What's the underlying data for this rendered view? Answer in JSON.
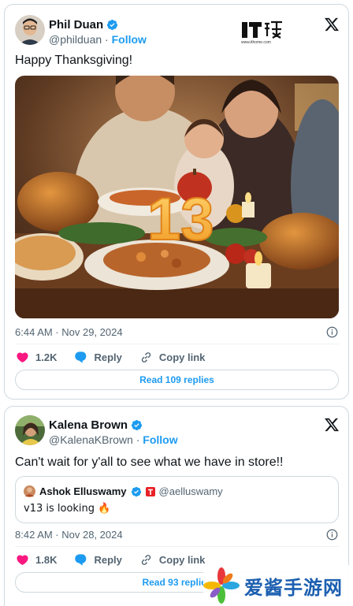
{
  "tweets": [
    {
      "author": {
        "name": "Phil Duan",
        "handle": "@philduan",
        "follow_label": "Follow"
      },
      "text": "Happy Thanksgiving!",
      "timestamp": "6:44 AM · Nov 29, 2024",
      "likes": "1.2K",
      "reply_label": "Reply",
      "copy_link_label": "Copy link",
      "read_replies_label": "Read 109 replies",
      "image_overlay_number": "13"
    },
    {
      "author": {
        "name": "Kalena Brown",
        "handle": "@KalenaKBrown",
        "follow_label": "Follow"
      },
      "text": "Can't wait for y'all to see what we have in store!!",
      "quote": {
        "name": "Ashok Elluswamy",
        "handle": "@aelluswamy",
        "text": "v13 is looking 🔥"
      },
      "timestamp": "8:42 AM · Nov 28, 2024",
      "likes": "1.8K",
      "reply_label": "Reply",
      "copy_link_label": "Copy link",
      "read_replies_label": "Read 93 replies"
    }
  ],
  "watermark": {
    "site": "www.ithome.com"
  },
  "brand": {
    "text": "爱酱手游网"
  },
  "colors": {
    "accent": "#1d9bf0",
    "heart": "#f91880",
    "text": "#0f1419",
    "muted": "#536471",
    "border": "#cfd9de"
  },
  "icons": [
    "verified-badge-icon",
    "x-logo-icon",
    "info-icon",
    "heart-icon",
    "reply-icon",
    "link-icon",
    "pinwheel-logo-icon"
  ]
}
